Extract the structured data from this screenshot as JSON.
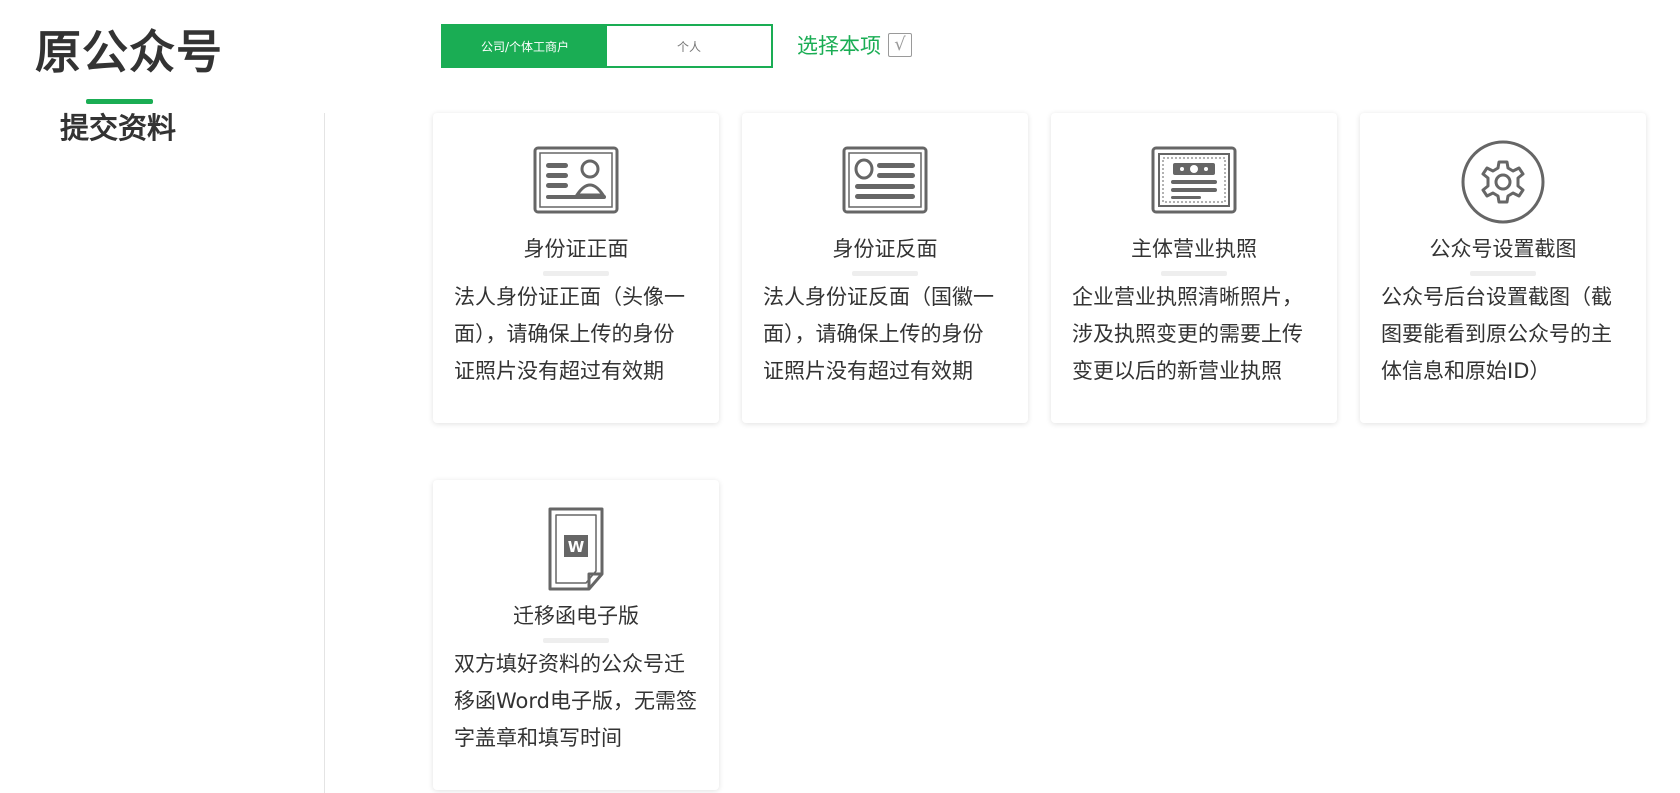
{
  "section": {
    "title": "原公众号",
    "subtitle": "提交资料"
  },
  "type_toggle": {
    "options": [
      {
        "label": "公司/个体工商户",
        "active": true
      },
      {
        "label": "个人",
        "active": false
      }
    ]
  },
  "select_item": {
    "label": "选择本项",
    "check_glyph": "√"
  },
  "cards": [
    {
      "title": "身份证正面",
      "icon": "id-card-front-icon",
      "desc_lines": [
        "法人身份证正面（头像一",
        "面），请确保上传的身份",
        "证照片没有超过有效期"
      ]
    },
    {
      "title": "身份证反面",
      "icon": "id-card-back-icon",
      "desc_lines": [
        "法人身份证反面（国徽一",
        "面），请确保上传的身份",
        "证照片没有超过有效期"
      ]
    },
    {
      "title": "主体营业执照",
      "icon": "business-license-icon",
      "desc_lines": [
        "企业营业执照清晰照片，",
        "涉及执照变更的需要上传",
        "变更以后的新营业执照"
      ]
    },
    {
      "title": "公众号设置截图",
      "icon": "gear-icon",
      "desc_lines": [
        "公众号后台设置截图（截",
        "图要能看到原公众号的主",
        "体信息和原始ID）"
      ]
    },
    {
      "title": "迁移函电子版",
      "icon": "word-document-icon",
      "desc_lines": [
        "双方填好资料的公众号迁",
        "移函Word电子版，无需签",
        "字盖章和填写时间"
      ]
    }
  ],
  "colors": {
    "accent": "#1aad54",
    "text": "#333333",
    "icon": "#666666"
  }
}
